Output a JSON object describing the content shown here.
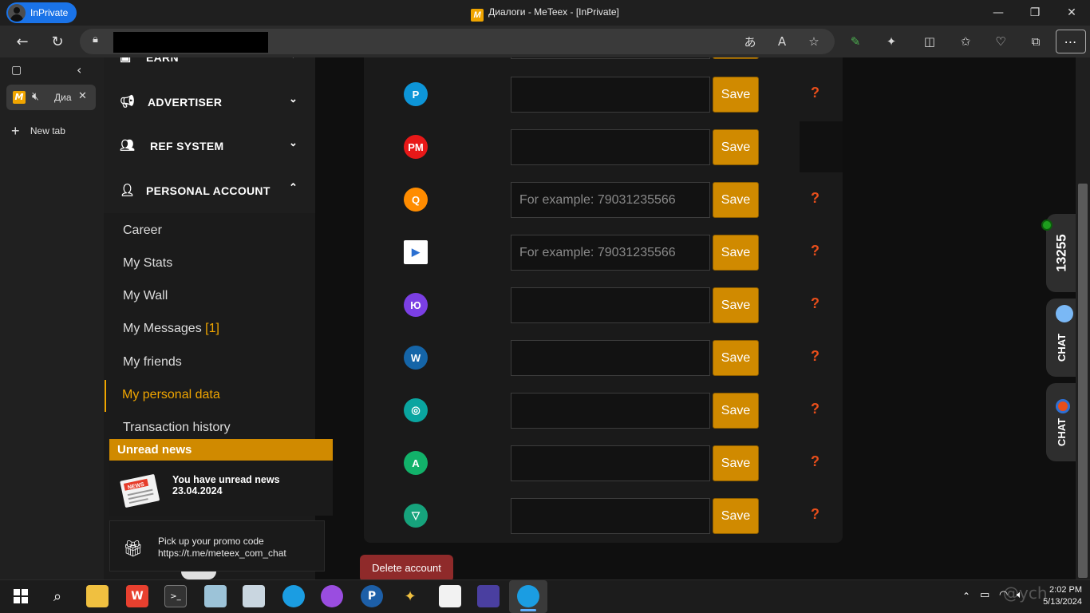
{
  "browser": {
    "inprivate_label": "InPrivate",
    "window_title": "Диалоги - MeTeex - [InPrivate]",
    "favicon_letter": "M",
    "tab_title": "Диа",
    "new_tab_label": "New tab"
  },
  "menu": {
    "top_items": [
      {
        "label": "EARN"
      },
      {
        "label": "ADVERTISER"
      },
      {
        "label": "REF SYSTEM"
      },
      {
        "label": "PERSONAL ACCOUNT"
      }
    ],
    "sub_items": [
      {
        "label": "Career"
      },
      {
        "label": "My Stats"
      },
      {
        "label": "My Wall"
      },
      {
        "label": "My Messages ",
        "badge": "[1]"
      },
      {
        "label": "My friends"
      },
      {
        "label": "My personal data"
      },
      {
        "label": "Transaction history"
      }
    ]
  },
  "news": {
    "header": "Unread news",
    "line1": "You have unread news",
    "line2": "23.04.2024",
    "promo_line1": "Pick up your promo code",
    "promo_line2": "https://t.me/meteex_com_chat",
    "news_stamp": "NEWS"
  },
  "wallets": {
    "save_label": "Save",
    "help_label": "?",
    "rows": [
      {
        "icon": "P",
        "color": "#0d95d8",
        "placeholder": "",
        "help": true
      },
      {
        "icon": "PM",
        "color": "#e81818",
        "placeholder": "",
        "help": false
      },
      {
        "icon": "Q",
        "color": "#ff8c00",
        "placeholder": "For example: 79031235566",
        "help": true
      },
      {
        "icon": "▶",
        "color": "#ffffff",
        "placeholder": "For example: 79031235566",
        "help": true
      },
      {
        "icon": "Ю",
        "color": "#7b3fe4",
        "placeholder": "",
        "help": true
      },
      {
        "icon": "W",
        "color": "#1565a8",
        "placeholder": "",
        "help": true
      },
      {
        "icon": "◎",
        "color": "#0aa5a0",
        "placeholder": "",
        "help": true
      },
      {
        "icon": "A",
        "color": "#12b26a",
        "placeholder": "",
        "help": true
      },
      {
        "icon": "▽",
        "color": "#16a37c",
        "placeholder": "",
        "help": true
      }
    ],
    "delete_label": "Delete account"
  },
  "side_widgets": {
    "counter": "13255",
    "chat1": "CHAT",
    "chat2": "CHAT"
  },
  "system": {
    "time": "2:02 PM",
    "date": "5/13/2024"
  }
}
